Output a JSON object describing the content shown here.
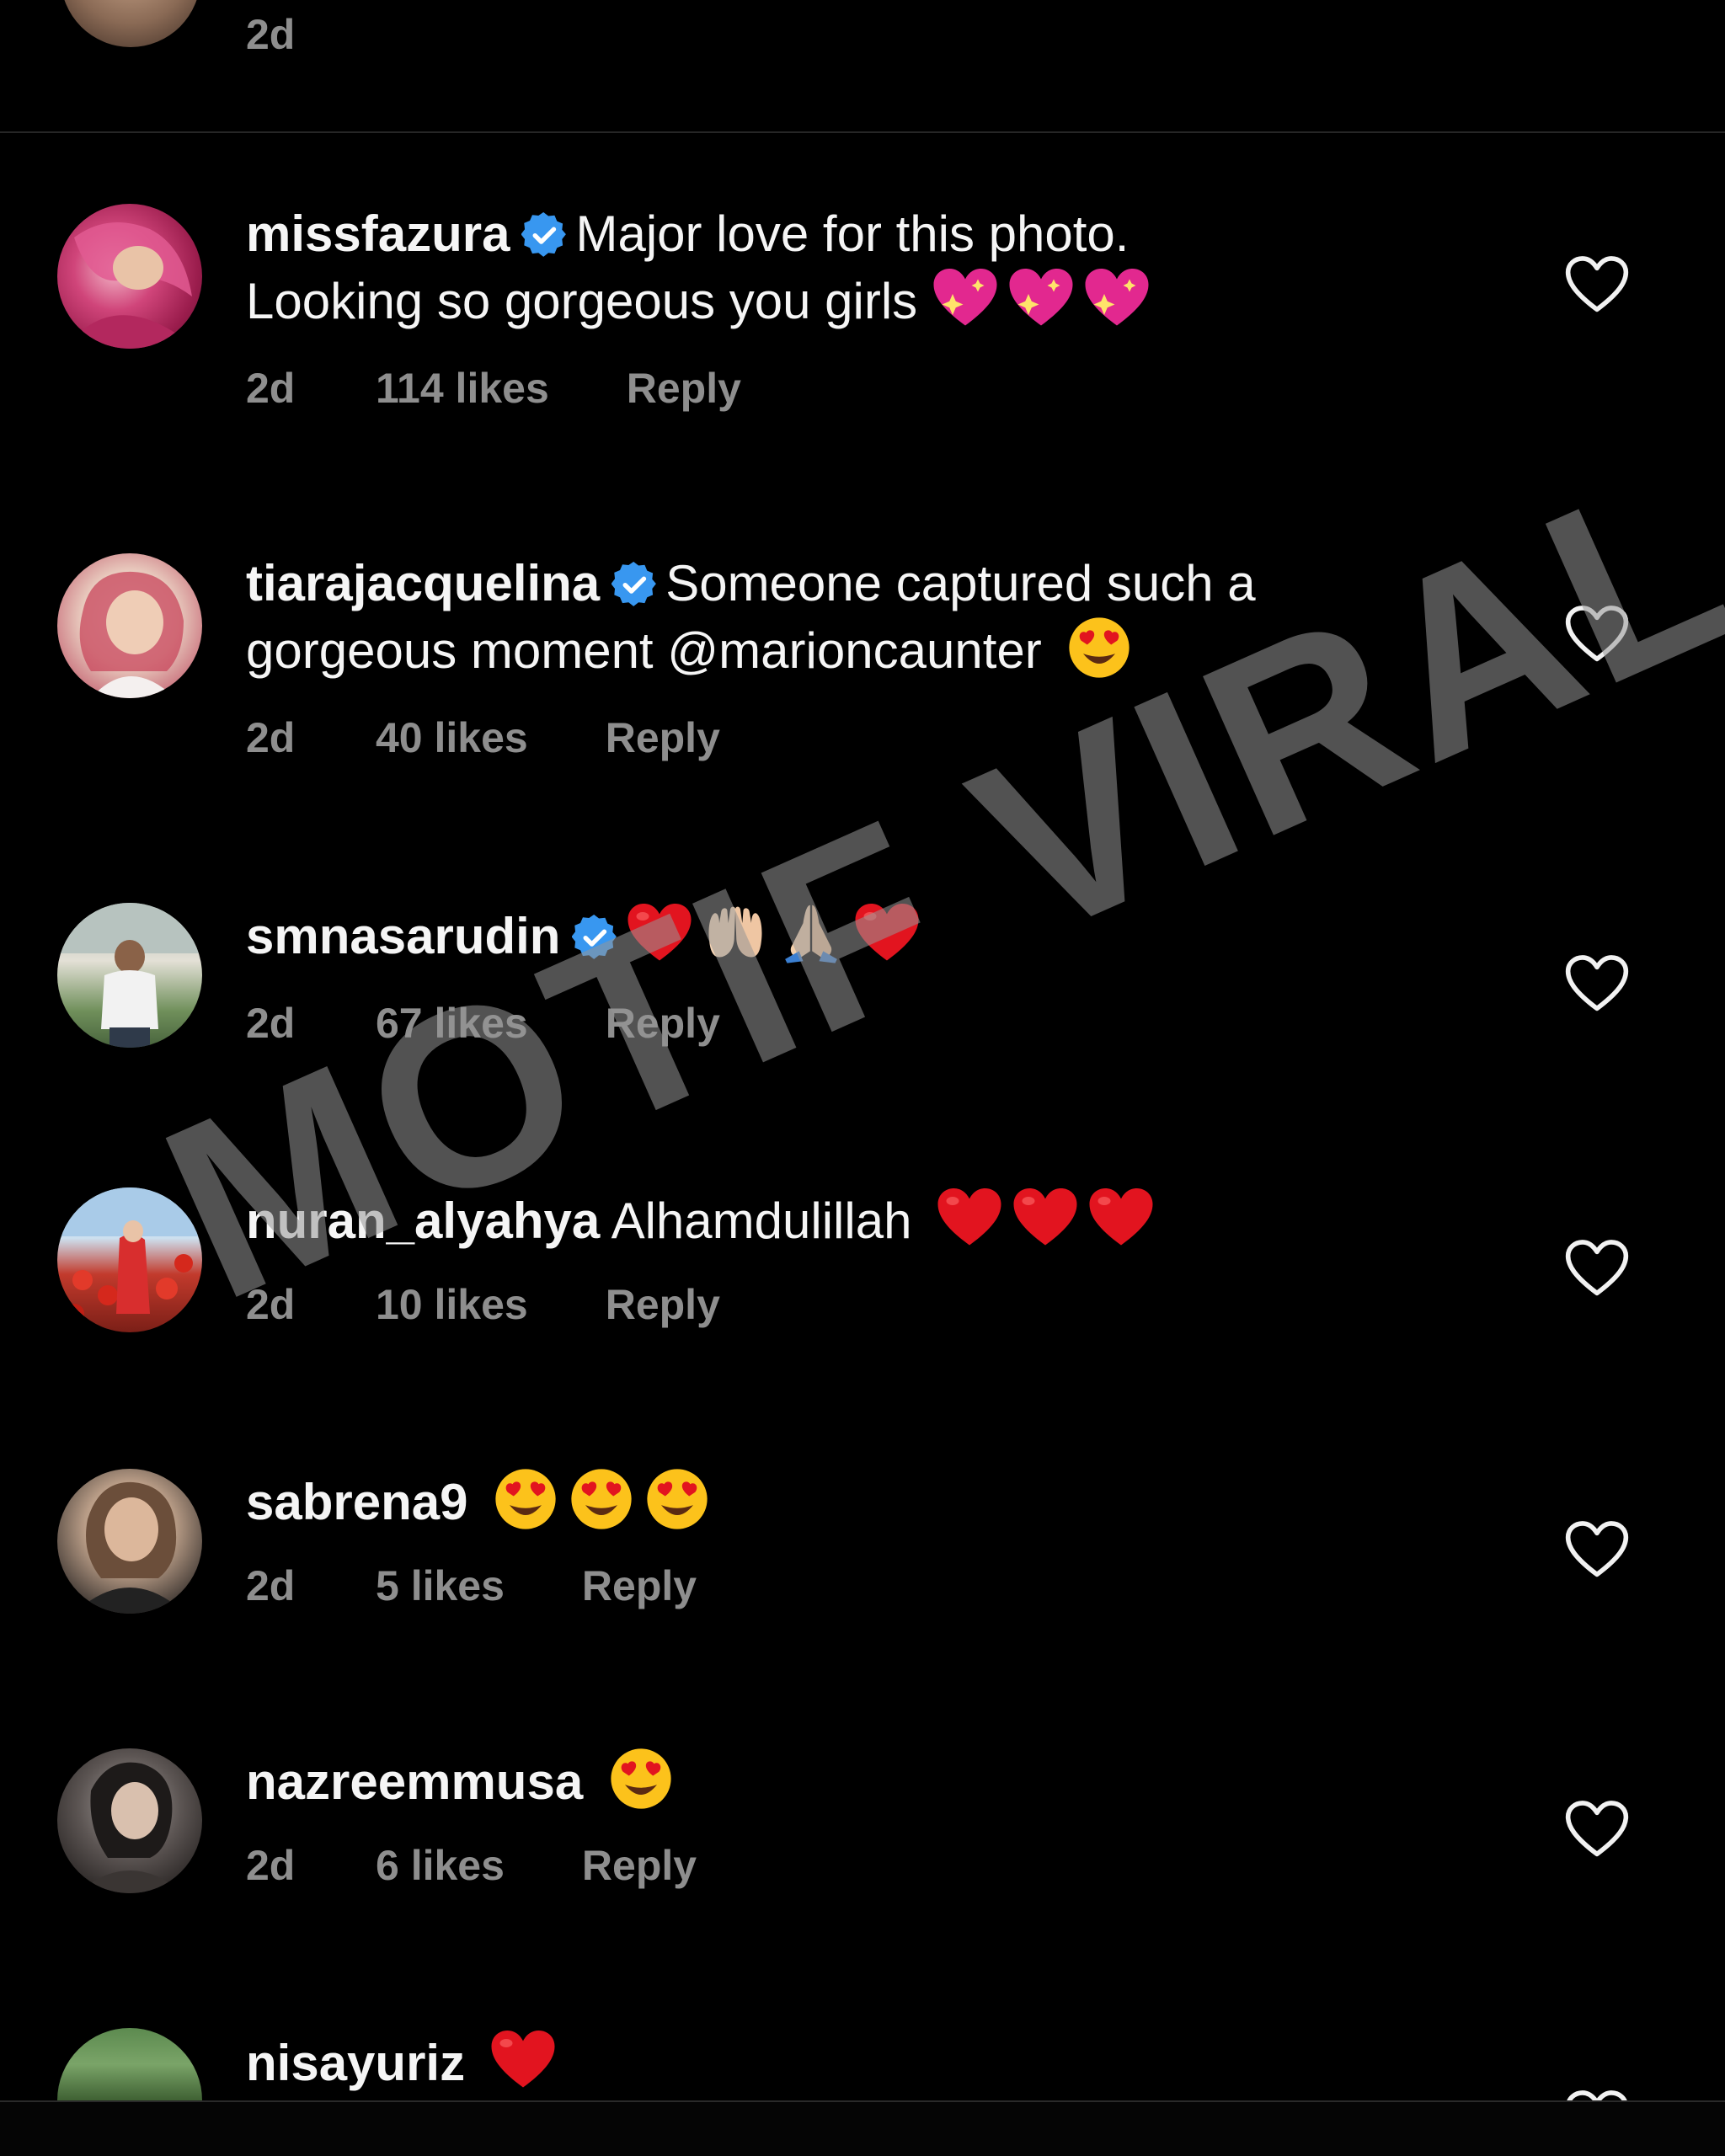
{
  "top_comment": {
    "time": "2d"
  },
  "comments": [
    {
      "username": "missfazura",
      "verified": true,
      "text_line1": "Major love for this photo.",
      "text_line2": "Looking so gorgeous you girls",
      "emojis": [
        "sparkling-heart",
        "sparkling-heart",
        "sparkling-heart"
      ],
      "time": "2d",
      "likes": "114 likes",
      "reply": "Reply"
    },
    {
      "username": "tiarajacquelina",
      "verified": true,
      "text_line1": "Someone captured such a",
      "text_line2": "gorgeous moment @marioncaunter",
      "emojis": [
        "heart-eyes"
      ],
      "time": "2d",
      "likes": "40 likes",
      "reply": "Reply"
    },
    {
      "username": "smnasarudin",
      "verified": true,
      "text_line1": "",
      "emojis": [
        "red-heart",
        "palms-up",
        "folded-hands",
        "red-heart"
      ],
      "time": "2d",
      "likes": "67 likes",
      "reply": "Reply"
    },
    {
      "username": "nuran_alyahya",
      "verified": false,
      "text_line1": "Alhamdulillah",
      "emojis": [
        "red-heart",
        "red-heart",
        "red-heart"
      ],
      "time": "2d",
      "likes": "10 likes",
      "reply": "Reply"
    },
    {
      "username": "sabrena9",
      "verified": false,
      "text_line1": "",
      "emojis": [
        "heart-eyes",
        "heart-eyes",
        "heart-eyes"
      ],
      "time": "2d",
      "likes": "5 likes",
      "reply": "Reply"
    },
    {
      "username": "nazreemmusa",
      "verified": false,
      "text_line1": "",
      "emojis": [
        "heart-eyes"
      ],
      "time": "2d",
      "likes": "6 likes",
      "reply": "Reply"
    },
    {
      "username": "nisayuriz",
      "verified": false,
      "text_line1": "",
      "emojis": [
        "red-heart"
      ]
    }
  ],
  "watermark": "MOTIF VIRAL",
  "colors": {
    "background": "#000000",
    "text": "#f5f5f5",
    "secondary_text": "#8e8e8e",
    "verified_blue": "#3897f0"
  }
}
